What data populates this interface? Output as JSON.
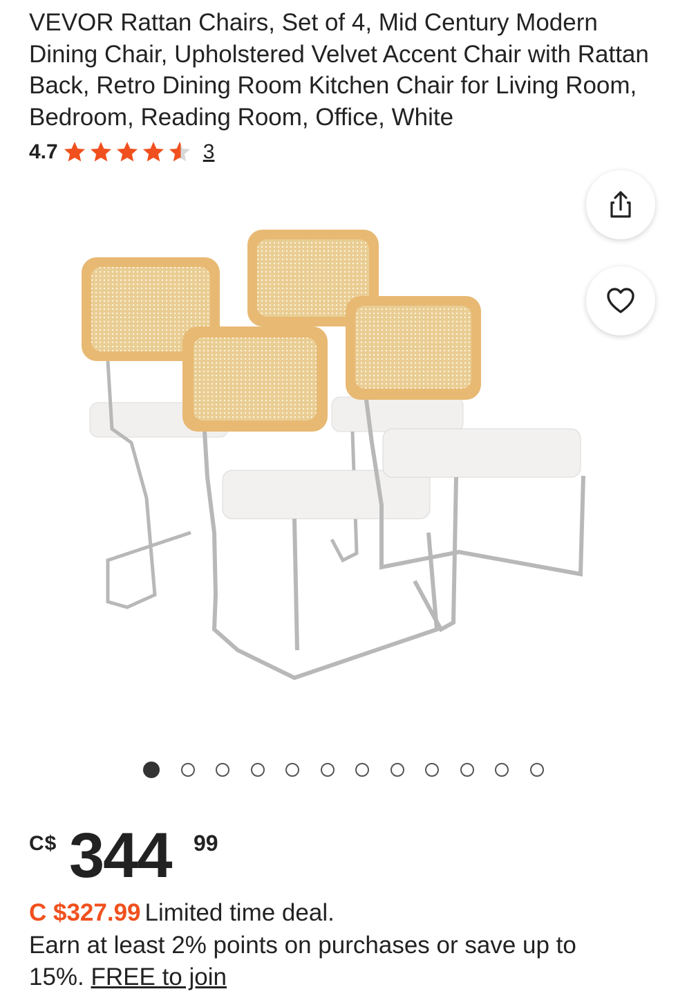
{
  "product": {
    "title": "VEVOR Rattan Chairs, Set of 4, Mid Century Modern Dining Chair, Upholstered Velvet Accent Chair with Rattan Back, Retro Dining Room Kitchen Chair for Living Room, Bedroom, Reading Room, Office, White",
    "rating": "4.7",
    "rating_stars": 4.7,
    "review_count": "3",
    "icons": {
      "share": "share-icon",
      "favorite": "heart-icon",
      "star": "star-icon"
    }
  },
  "gallery": {
    "total_images": 12,
    "active_index": 0
  },
  "pricing": {
    "currency_symbol": "C$",
    "price_main": "344",
    "price_cents": "99",
    "deal_price": "C $327.99",
    "deal_label": "Limited time deal.",
    "points_text": "Earn at least 2% points on purchases or save up to 15%.",
    "join_link": "FREE to join"
  },
  "colors": {
    "accent": "#f0501e",
    "star": "#f0501e",
    "text": "#222222"
  }
}
